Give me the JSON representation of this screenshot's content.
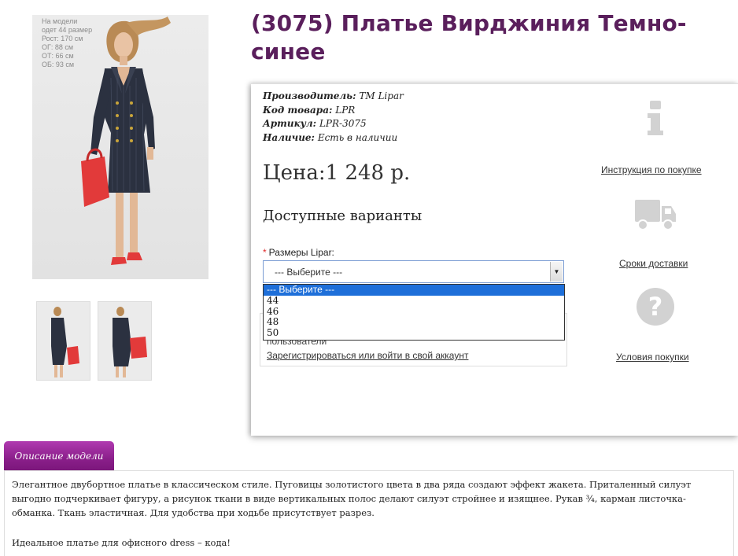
{
  "gallery": {
    "model_params": [
      "На модели",
      "одет 44 размер",
      "Рост: 170 см",
      "ОГ: 88 см",
      "ОТ: 66 см",
      "ОБ: 93 см"
    ]
  },
  "product": {
    "title": "(3075) Платье Вирджиния Темно-синее",
    "manufacturer_label": "Производитель:",
    "manufacturer_value": "TM Lipar",
    "code_label": "Код товара:",
    "code_value": "LPR",
    "article_label": "Артикул:",
    "article_value": "LPR-3075",
    "availability_label": "Наличие:",
    "availability_value": "Есть в наличии",
    "price": "Цена:1 248 р.",
    "variants_heading": "Доступные варианты",
    "size_required_mark": "*",
    "size_label": "Размеры Lipar:",
    "size_selected": "--- Выберите ---",
    "size_options": [
      "--- Выберите ---",
      "44",
      "46",
      "48",
      "50"
    ]
  },
  "login": {
    "text": "пользователи",
    "link": "Зарегистрироваться или войти в свой аккаунт"
  },
  "side_links": {
    "instructions": "Инструкция по покупке",
    "delivery": "Сроки доставки",
    "conditions": "Условия покупки"
  },
  "tabs": {
    "description": "Описание модели"
  },
  "description": {
    "paragraph1": "Элегантное двубортное платье в классическом стиле. Пуговицы золотистого цвета в два ряда создают эффект жакета. Приталенный силуэт выгодно подчеркивает фигуру, а рисунок ткани в виде вертикальных полос делают силуэт стройнее и изящнее. Рукав ¾, карман листочка-обманка. Ткань эластичная. Для удобства при ходьбе присутствует разрез.",
    "paragraph2": "Идеальное платье для офисного dress – кода!"
  },
  "colors": {
    "title": "#5a1f5c",
    "tab": "#8a1f8a",
    "dropdown_highlight": "#1e6fd9",
    "icon_gray": "#d2d2d2",
    "dress": "#2b3140",
    "bag": "#e23a3a"
  }
}
